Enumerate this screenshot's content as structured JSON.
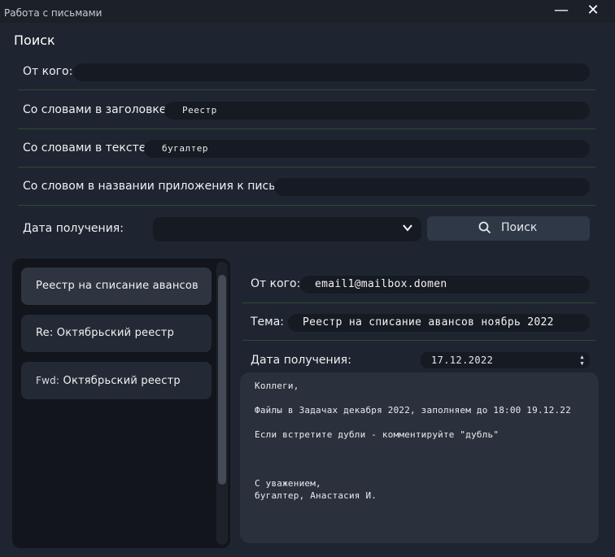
{
  "window": {
    "title": "Работа с письмами",
    "minimize_glyph": "—",
    "close_glyph": "✕"
  },
  "search": {
    "section_title": "Поиск",
    "from_label": "От кого:",
    "from_value": "",
    "subject_label": "Со словами в заголовке:",
    "subject_value": "Реестр",
    "text_label": "Со словами в тексте:",
    "text_value": "бугалтер",
    "attachment_label": "Со словом в названии приложения к письму:",
    "attachment_value": "",
    "date_label": "Дата получения:",
    "date_value": "",
    "search_button": "Поиск",
    "icons": {
      "search": "search-icon",
      "dropdown": "chevron-down-icon"
    }
  },
  "messages": [
    {
      "prefix": "",
      "title": "Реестр на списание авансов",
      "selected": true
    },
    {
      "prefix": "",
      "title": "Re: Октябрьский реестр",
      "selected": false
    },
    {
      "prefix": "Fwd:",
      "title": "Октябрьский реестр",
      "selected": false
    }
  ],
  "detail": {
    "from_label": "От кого:",
    "from_value": "email1@mailbox.domen",
    "subject_label": "Тема:",
    "subject_value": "Реестр на списание авансов ноябрь 2022",
    "date_label": "Дата получения:",
    "date_value": "17.12.2022",
    "body": [
      "Коллеги,",
      "",
      "Файлы в Задачах декабря 2022, заполняем до 18:00 19.12.22",
      "",
      "Если встретите дубли - комментируйте \"дубль\"",
      "",
      "",
      "",
      "С уважением,",
      "бугалтер, Анастасия И."
    ]
  },
  "colors": {
    "background": "#1f2530",
    "field": "#161a22",
    "separator": "#2c4a33",
    "button": "#2f3846"
  }
}
